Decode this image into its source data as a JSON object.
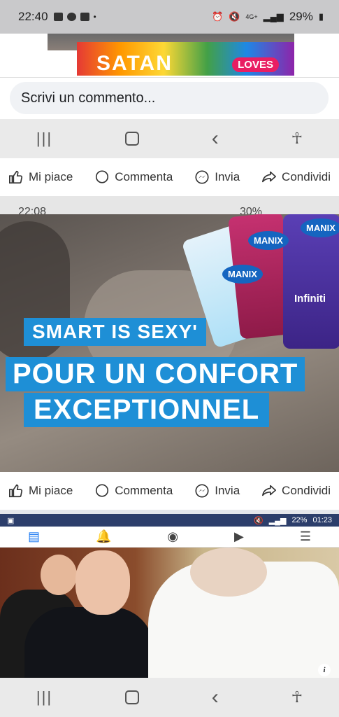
{
  "status_bar": {
    "time": "22:40",
    "network": "4G+",
    "battery": "29%"
  },
  "banner": {
    "text_left": "SATAN",
    "text_right": "LOVES"
  },
  "comment": {
    "placeholder": "Scrivi un commento..."
  },
  "reactions": {
    "like": "Mi piace",
    "comment": "Commenta",
    "send": "Invia",
    "share": "Condividi"
  },
  "status_bar_2": {
    "time": "22:08",
    "battery": "30%"
  },
  "ad": {
    "line1": "SMART IS SEXY'",
    "line2": "POUR UN CONFORT",
    "line3": "EXCEPTIONNEL",
    "brand": "MANIX",
    "product": "Infiniti"
  },
  "status_bar_3": {
    "battery": "22%",
    "time": "01:23"
  },
  "photo": {
    "info": "i"
  }
}
